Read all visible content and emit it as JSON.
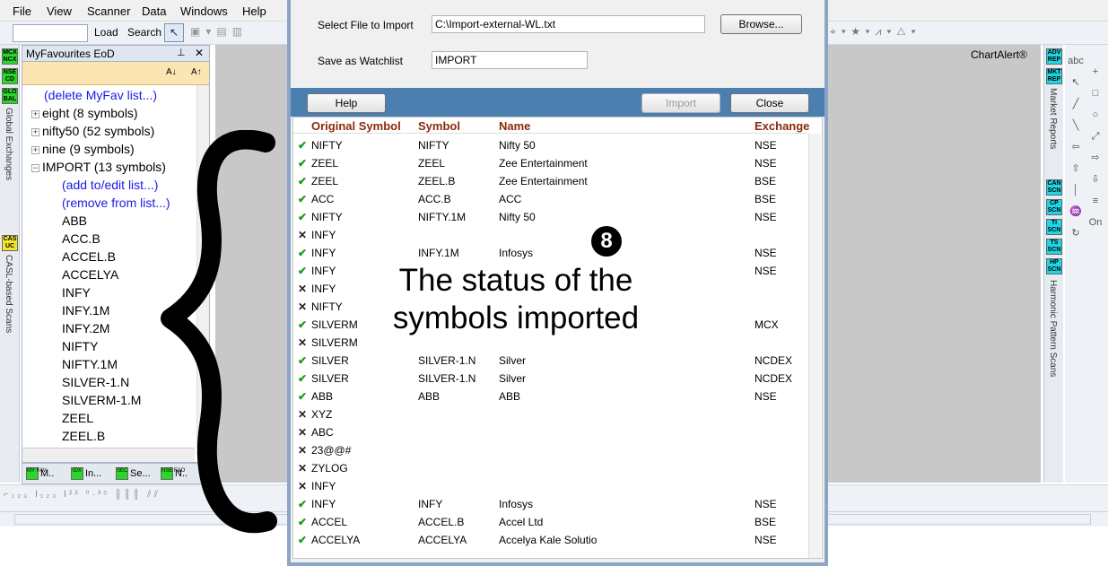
{
  "menu": [
    "File",
    "View",
    "Scanner",
    "Data",
    "Windows",
    "Help"
  ],
  "toolbar": {
    "load_label": "Load",
    "search_label": "Search"
  },
  "chart": {
    "title": "ChartAlert®"
  },
  "left_tabs": {
    "tags": [
      "MCX NCX",
      "NSE CD",
      "GLO BAL",
      "CAS UC"
    ],
    "global_exchanges": "Global Exchanges",
    "casl_scans": "CASL-based Scans"
  },
  "favourites": {
    "title": "MyFavourites EoD",
    "sort_asc": "A↓",
    "sort_desc": "A↑",
    "items": [
      {
        "text": "(delete MyFav list...)",
        "kind": "link",
        "indent": 0
      },
      {
        "text": "eight (8 symbols)",
        "kind": "group",
        "indent": 0
      },
      {
        "text": "nifty50 (52 symbols)",
        "kind": "group",
        "indent": 0
      },
      {
        "text": "nine (9 symbols)",
        "kind": "group",
        "indent": 0
      },
      {
        "text": "IMPORT (13 symbols)",
        "kind": "group-open",
        "indent": 0
      },
      {
        "text": "(add to/edit list...)",
        "kind": "link",
        "indent": 1
      },
      {
        "text": "(remove from list...)",
        "kind": "link",
        "indent": 1
      },
      {
        "text": "ABB",
        "kind": "item",
        "indent": 1
      },
      {
        "text": "ACC.B",
        "kind": "item",
        "indent": 1
      },
      {
        "text": "ACCEL.B",
        "kind": "item",
        "indent": 1
      },
      {
        "text": "ACCELYA",
        "kind": "item",
        "indent": 1
      },
      {
        "text": "INFY",
        "kind": "item",
        "indent": 1
      },
      {
        "text": "INFY.1M",
        "kind": "item",
        "indent": 1
      },
      {
        "text": "INFY.2M",
        "kind": "item",
        "indent": 1
      },
      {
        "text": "NIFTY",
        "kind": "item",
        "indent": 1
      },
      {
        "text": "NIFTY.1M",
        "kind": "item",
        "indent": 1
      },
      {
        "text": "SILVER-1.N",
        "kind": "item",
        "indent": 1
      },
      {
        "text": "SILVERM-1.M",
        "kind": "item",
        "indent": 1
      },
      {
        "text": "ZEEL",
        "kind": "item",
        "indent": 1
      },
      {
        "text": "ZEEL.B",
        "kind": "item",
        "indent": 1
      }
    ],
    "tabs": [
      {
        "tag": "MY FAV",
        "label": "M.."
      },
      {
        "tag": "IDX",
        "label": "In..."
      },
      {
        "tag": "SEC",
        "label": "Se..."
      },
      {
        "tag": "NSE F&O",
        "label": "N.."
      }
    ]
  },
  "right_tabs": {
    "tags": [
      "ADV REP",
      "MKT REP",
      "CAN SCN",
      "CP SCN",
      "TI SCN",
      "TS SCN",
      "HP SCN"
    ],
    "market_reports": "Market Reports",
    "harmonic_scans": "Harmonic Pattern Scans"
  },
  "right_tools": [
    "abc",
    "+",
    "↖",
    "□",
    "╱",
    "○",
    "╲",
    "⤢",
    "⇦",
    "⇨",
    "⇧",
    "⇩",
    "│",
    "≡",
    "♒",
    "On",
    "↻"
  ],
  "dialog": {
    "select_file_label": "Select File to Import",
    "file_path": "C:\\Import-external-WL.txt",
    "browse_label": "Browse...",
    "save_as_label": "Save as Watchlist",
    "watchlist_name": "IMPORT",
    "help_label": "Help",
    "import_label": "Import",
    "close_label": "Close",
    "columns": [
      "Original Symbol",
      "Symbol",
      "Name",
      "Exchange"
    ],
    "rows": [
      {
        "status": "✔",
        "ok": true,
        "original": "NIFTY",
        "symbol": "NIFTY",
        "name": "Nifty 50",
        "exchange": "NSE"
      },
      {
        "status": "✔",
        "ok": true,
        "original": "ZEEL",
        "symbol": "ZEEL",
        "name": "Zee Entertainment",
        "exchange": "NSE"
      },
      {
        "status": "✔",
        "ok": true,
        "original": "ZEEL",
        "symbol": "ZEEL.B",
        "name": "Zee Entertainment",
        "exchange": "BSE"
      },
      {
        "status": "✔",
        "ok": true,
        "original": "ACC",
        "symbol": "ACC.B",
        "name": "ACC",
        "exchange": "BSE"
      },
      {
        "status": "✔",
        "ok": true,
        "original": "NIFTY",
        "symbol": "NIFTY.1M",
        "name": "Nifty 50",
        "exchange": "NSE"
      },
      {
        "status": "✕",
        "ok": false,
        "original": "INFY",
        "symbol": "",
        "name": "",
        "exchange": ""
      },
      {
        "status": "✔",
        "ok": true,
        "original": "INFY",
        "symbol": "INFY.1M",
        "name": "Infosys",
        "exchange": "NSE"
      },
      {
        "status": "✔",
        "ok": true,
        "original": "INFY",
        "symbol": "",
        "name": "",
        "exchange": "NSE"
      },
      {
        "status": "✕",
        "ok": false,
        "original": "INFY",
        "symbol": "",
        "name": "",
        "exchange": ""
      },
      {
        "status": "✕",
        "ok": false,
        "original": "NIFTY",
        "symbol": "",
        "name": "",
        "exchange": ""
      },
      {
        "status": "✔",
        "ok": true,
        "original": "SILVERM",
        "symbol": "",
        "name": "",
        "exchange": "MCX"
      },
      {
        "status": "✕",
        "ok": false,
        "original": "SILVERM",
        "symbol": "",
        "name": "",
        "exchange": ""
      },
      {
        "status": "✔",
        "ok": true,
        "original": "SILVER",
        "symbol": "SILVER-1.N",
        "name": "Silver",
        "exchange": "NCDEX"
      },
      {
        "status": "✔",
        "ok": true,
        "original": "SILVER",
        "symbol": "SILVER-1.N",
        "name": "Silver",
        "exchange": "NCDEX"
      },
      {
        "status": "✔",
        "ok": true,
        "original": "ABB",
        "symbol": "ABB",
        "name": "ABB",
        "exchange": "NSE"
      },
      {
        "status": "✕",
        "ok": false,
        "original": "XYZ",
        "symbol": "",
        "name": "",
        "exchange": ""
      },
      {
        "status": "✕",
        "ok": false,
        "original": "ABC",
        "symbol": "",
        "name": "",
        "exchange": ""
      },
      {
        "status": "✕",
        "ok": false,
        "original": "23@@#",
        "symbol": "",
        "name": "",
        "exchange": ""
      },
      {
        "status": "✕",
        "ok": false,
        "original": "ZYLOG",
        "symbol": "",
        "name": "",
        "exchange": ""
      },
      {
        "status": "✕",
        "ok": false,
        "original": "INFY",
        "symbol": "",
        "name": "",
        "exchange": ""
      },
      {
        "status": "✔",
        "ok": true,
        "original": "INFY",
        "symbol": "INFY",
        "name": "Infosys",
        "exchange": "NSE"
      },
      {
        "status": "✔",
        "ok": true,
        "original": "ACCEL",
        "symbol": "ACCEL.B",
        "name": "Accel Ltd",
        "exchange": "BSE"
      },
      {
        "status": "✔",
        "ok": true,
        "original": "ACCELYA",
        "symbol": "ACCELYA",
        "name": "Accelya Kale Solutio",
        "exchange": "NSE"
      }
    ]
  },
  "annotation": {
    "badge": "8",
    "text": "The status of the symbols imported"
  },
  "colors": {
    "ok": "#1a9a1a",
    "band": "#4a7fb0",
    "header_text": "#8a2b0a",
    "link": "#1a1ae6",
    "sort_bar": "#fbe5b3"
  }
}
